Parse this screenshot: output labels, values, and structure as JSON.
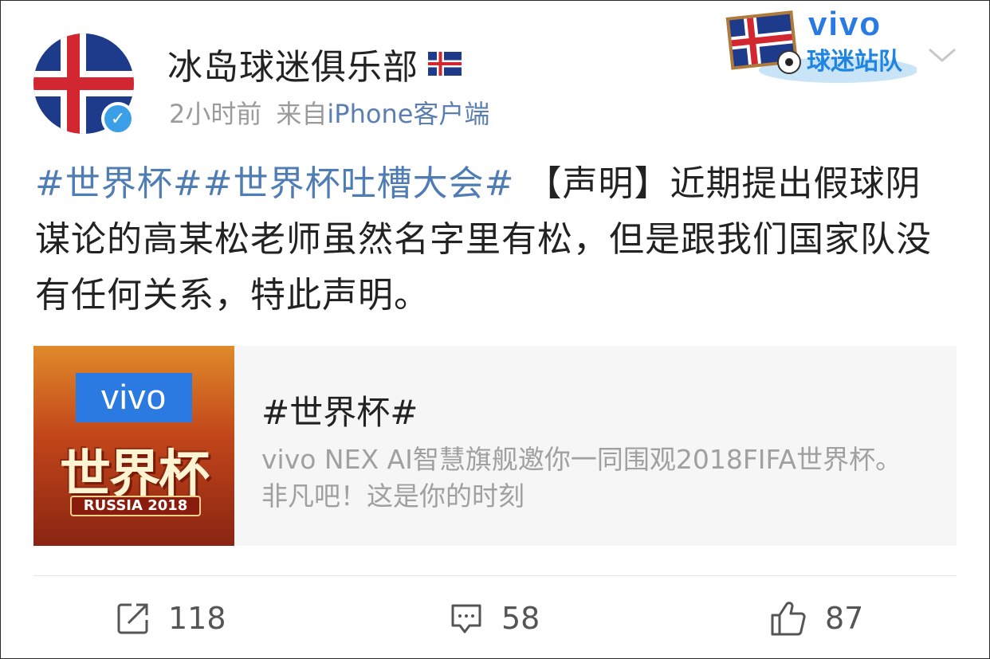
{
  "post": {
    "username": "冰岛球迷俱乐部",
    "time": "2小时前",
    "source_prefix": "来自",
    "source_name": "iPhone客户端",
    "badge_brand": "vivo",
    "badge_label": "球迷站队",
    "hashtags": "#世界杯##世界杯吐槽大会#",
    "text": "【声明】近期提出假球阴谋论的高某松老师虽然名字里有松，但是跟我们国家队没有任何关系，特此声明。"
  },
  "card": {
    "thumb_brand": "vivo",
    "thumb_title": "世界杯",
    "thumb_sub": "RUSSIA 2018",
    "title": "#世界杯#",
    "desc": "vivo NEX AI智慧旗舰邀你一同围观2018FIFA世界杯。非凡吧！这是你的时刻"
  },
  "actions": {
    "repost_count": "118",
    "comment_count": "58",
    "like_count": "87"
  },
  "colors": {
    "link": "#4f7cb3",
    "meta_gray": "#9b9b9b",
    "brand_blue": "#2a7ae2",
    "iceland_blue": "#1e3a8a",
    "iceland_red": "#d22630"
  },
  "icons": [
    "iceland-flag-icon",
    "verified-icon",
    "chevron-down-icon",
    "repost-icon",
    "comment-icon",
    "like-icon"
  ]
}
